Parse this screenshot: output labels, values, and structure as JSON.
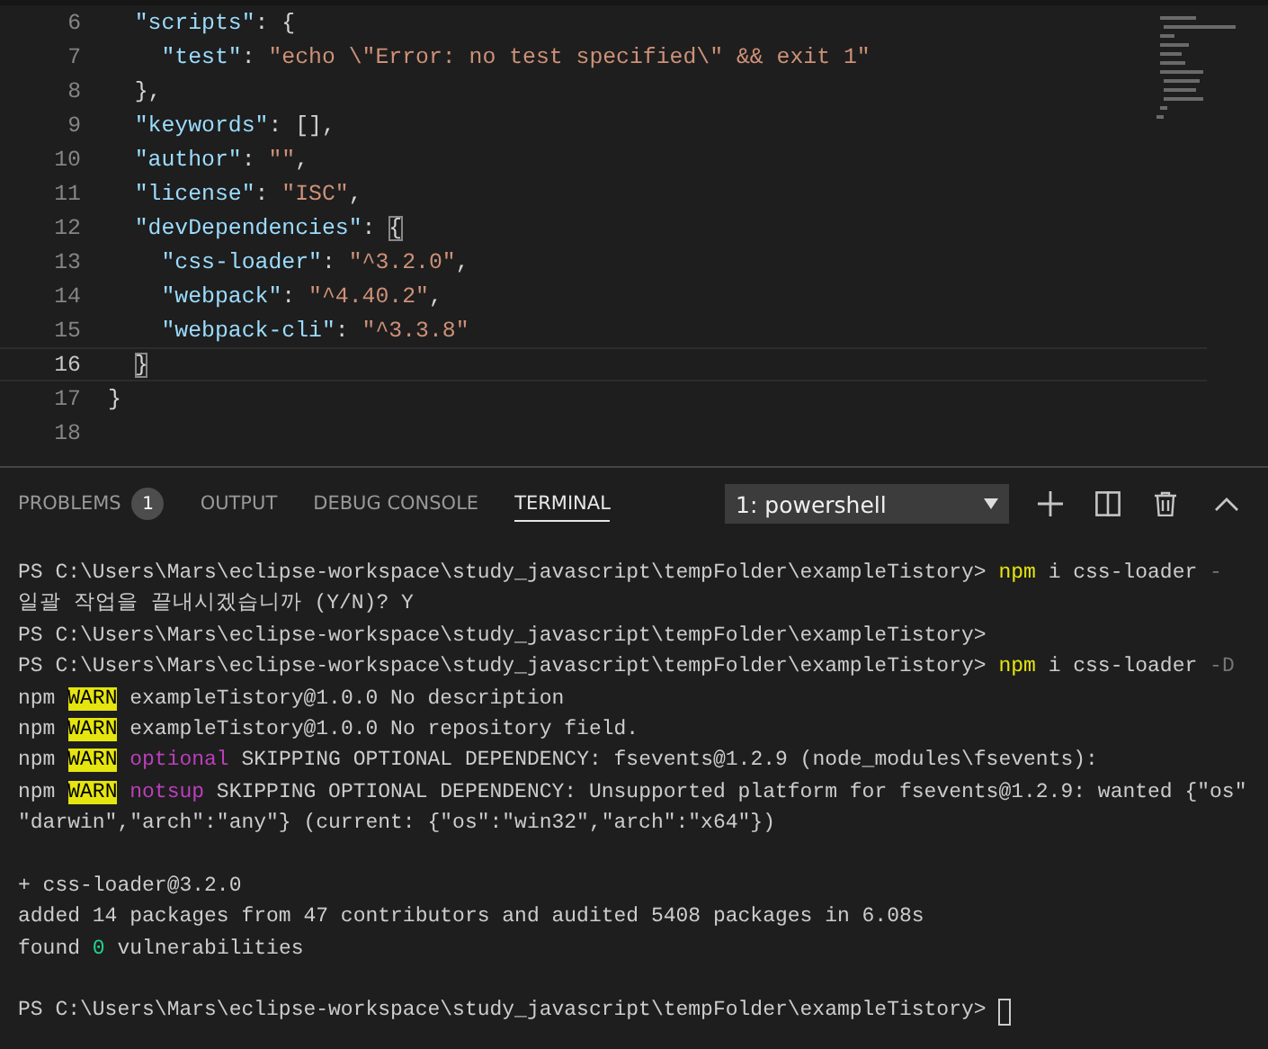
{
  "editor": {
    "lines": [
      {
        "number": "6",
        "current": false,
        "segments": [
          {
            "kind": "key",
            "text": "  \"scripts\""
          },
          {
            "kind": "punct",
            "text": ": {"
          }
        ]
      },
      {
        "number": "7",
        "current": false,
        "segments": [
          {
            "kind": "key",
            "text": "    \"test\""
          },
          {
            "kind": "punct",
            "text": ": "
          },
          {
            "kind": "str",
            "text": "\"echo \\\"Error: no test specified\\\" && exit 1\""
          }
        ]
      },
      {
        "number": "8",
        "current": false,
        "segments": [
          {
            "kind": "punct",
            "text": "  },"
          }
        ]
      },
      {
        "number": "9",
        "current": false,
        "segments": [
          {
            "kind": "key",
            "text": "  \"keywords\""
          },
          {
            "kind": "punct",
            "text": ": [],"
          }
        ]
      },
      {
        "number": "10",
        "current": false,
        "segments": [
          {
            "kind": "key",
            "text": "  \"author\""
          },
          {
            "kind": "punct",
            "text": ": "
          },
          {
            "kind": "str",
            "text": "\"\""
          },
          {
            "kind": "punct",
            "text": ","
          }
        ]
      },
      {
        "number": "11",
        "current": false,
        "segments": [
          {
            "kind": "key",
            "text": "  \"license\""
          },
          {
            "kind": "punct",
            "text": ": "
          },
          {
            "kind": "str",
            "text": "\"ISC\""
          },
          {
            "kind": "punct",
            "text": ","
          }
        ]
      },
      {
        "number": "12",
        "current": false,
        "segments": [
          {
            "kind": "key",
            "text": "  \"devDependencies\""
          },
          {
            "kind": "punct",
            "text": ": "
          },
          {
            "kind": "bracket",
            "text": "{"
          }
        ]
      },
      {
        "number": "13",
        "current": false,
        "segments": [
          {
            "kind": "key",
            "text": "    \"css-loader\""
          },
          {
            "kind": "punct",
            "text": ": "
          },
          {
            "kind": "str",
            "text": "\"^3.2.0\""
          },
          {
            "kind": "punct",
            "text": ","
          }
        ]
      },
      {
        "number": "14",
        "current": false,
        "segments": [
          {
            "kind": "key",
            "text": "    \"webpack\""
          },
          {
            "kind": "punct",
            "text": ": "
          },
          {
            "kind": "str",
            "text": "\"^4.40.2\""
          },
          {
            "kind": "punct",
            "text": ","
          }
        ]
      },
      {
        "number": "15",
        "current": false,
        "segments": [
          {
            "kind": "key",
            "text": "    \"webpack-cli\""
          },
          {
            "kind": "punct",
            "text": ": "
          },
          {
            "kind": "str",
            "text": "\"^3.3.8\""
          }
        ]
      },
      {
        "number": "16",
        "current": true,
        "segments": [
          {
            "kind": "bracket",
            "text": "}"
          }
        ]
      },
      {
        "number": "17",
        "current": false,
        "segments": [
          {
            "kind": "punct",
            "text": "}"
          }
        ]
      },
      {
        "number": "18",
        "current": false
      }
    ]
  },
  "panel": {
    "tabs": [
      {
        "label": "PROBLEMS",
        "badge": "1",
        "selected": false
      },
      {
        "label": "OUTPUT",
        "selected": false
      },
      {
        "label": "DEBUG CONSOLE",
        "selected": false
      },
      {
        "label": "TERMINAL",
        "selected": true
      }
    ],
    "terminal_select": {
      "value": "1: powershell"
    }
  },
  "terminal": {
    "lines": [
      {
        "segments": [
          {
            "kind": "plain",
            "text": "PS C:\\Users\\Mars\\eclipse-workspace\\study_javascript\\tempFolder\\exampleTistory> "
          },
          {
            "kind": "cmd",
            "text": "npm"
          },
          {
            "kind": "plain",
            "text": " i css-loader "
          },
          {
            "kind": "dim",
            "text": "-"
          }
        ]
      },
      {
        "segments": [
          {
            "kind": "plain",
            "text": "일괄 작업을 끝내시겠습니까 (Y/N)? Y"
          }
        ]
      },
      {
        "segments": [
          {
            "kind": "plain",
            "text": "PS C:\\Users\\Mars\\eclipse-workspace\\study_javascript\\tempFolder\\exampleTistory>"
          }
        ]
      },
      {
        "segments": [
          {
            "kind": "plain",
            "text": "PS C:\\Users\\Mars\\eclipse-workspace\\study_javascript\\tempFolder\\exampleTistory> "
          },
          {
            "kind": "cmd",
            "text": "npm"
          },
          {
            "kind": "plain",
            "text": " i css-loader "
          },
          {
            "kind": "dim",
            "text": "-D"
          }
        ]
      },
      {
        "segments": [
          {
            "kind": "plain",
            "text": "npm "
          },
          {
            "kind": "warn",
            "text": "WARN"
          },
          {
            "kind": "plain",
            "text": " exampleTistory@1.0.0 No description"
          }
        ]
      },
      {
        "segments": [
          {
            "kind": "plain",
            "text": "npm "
          },
          {
            "kind": "warn",
            "text": "WARN"
          },
          {
            "kind": "plain",
            "text": " exampleTistory@1.0.0 No repository field."
          }
        ]
      },
      {
        "segments": [
          {
            "kind": "plain",
            "text": "npm "
          },
          {
            "kind": "warn",
            "text": "WARN"
          },
          {
            "kind": "magenta",
            "text": " optional"
          },
          {
            "kind": "plain",
            "text": " SKIPPING OPTIONAL DEPENDENCY: fsevents@1.2.9 (node_modules\\fsevents):"
          }
        ]
      },
      {
        "segments": [
          {
            "kind": "plain",
            "text": "npm "
          },
          {
            "kind": "warn",
            "text": "WARN"
          },
          {
            "kind": "magenta",
            "text": " notsup"
          },
          {
            "kind": "plain",
            "text": " SKIPPING OPTIONAL DEPENDENCY: Unsupported platform for fsevents@1.2.9: wanted {\"os\""
          }
        ]
      },
      {
        "segments": [
          {
            "kind": "plain",
            "text": "\"darwin\",\"arch\":\"any\"} (current: {\"os\":\"win32\",\"arch\":\"x64\"})"
          }
        ]
      },
      {
        "gap_before": true,
        "segments": [
          {
            "kind": "plain",
            "text": "+ css-loader@3.2.0"
          }
        ]
      },
      {
        "segments": [
          {
            "kind": "plain",
            "text": "added 14 packages from 47 contributors and audited 5408 packages in 6.08s"
          }
        ]
      },
      {
        "segments": [
          {
            "kind": "plain",
            "text": "found "
          },
          {
            "kind": "green",
            "text": "0"
          },
          {
            "kind": "plain",
            "text": " vulnerabilities"
          }
        ]
      },
      {
        "gap_before": true,
        "cursor": true,
        "segments": [
          {
            "kind": "plain",
            "text": "PS C:\\Users\\Mars\\eclipse-workspace\\study_javascript\\tempFolder\\exampleTistory> "
          }
        ]
      }
    ]
  }
}
